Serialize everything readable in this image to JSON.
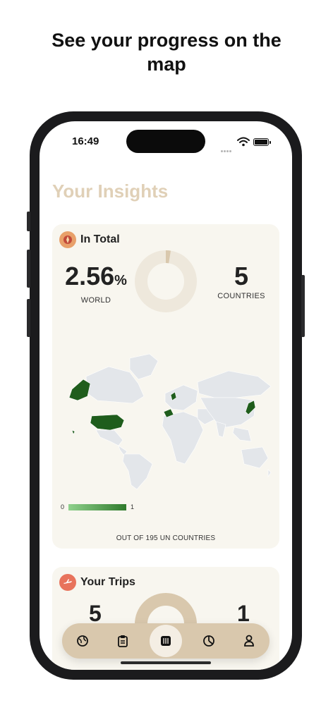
{
  "headline": {
    "line1": "See your progress on the",
    "line2": "map"
  },
  "status_bar": {
    "time": "16:49"
  },
  "page": {
    "title": "Your Insights"
  },
  "total_card": {
    "title": "In Total",
    "world_percent": "2.56",
    "percent_sign": "%",
    "world_label": "WORLD",
    "countries_value": "5",
    "countries_label": "COUNTRIES",
    "progress_fraction": 0.0256,
    "legend_min": "0",
    "legend_max": "1",
    "footnote": "OUT OF 195 UN COUNTRIES",
    "visited_color": "#1f5d1c"
  },
  "trips_card": {
    "title": "Your Trips",
    "left_value": "5",
    "right_value": "1"
  },
  "tabbar": {
    "tabs": [
      {
        "icon": "globe-icon",
        "active": false
      },
      {
        "icon": "clipboard-icon",
        "active": false
      },
      {
        "icon": "map-icon",
        "active": true
      },
      {
        "icon": "pie-chart-icon",
        "active": false
      },
      {
        "icon": "person-icon",
        "active": false
      }
    ]
  },
  "colors": {
    "accent": "#d9c8ad",
    "title": "#e0d0b7",
    "card": "#f8f6ef"
  }
}
